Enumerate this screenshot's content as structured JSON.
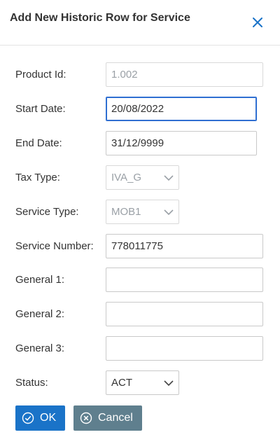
{
  "dialog": {
    "title": "Add New Historic Row for Service",
    "close_icon": "close-icon"
  },
  "form": {
    "product_id": {
      "label": "Product Id:",
      "value": "1.002",
      "disabled": true
    },
    "start_date": {
      "label": "Start Date:",
      "value": "20/08/2022",
      "focused": true
    },
    "end_date": {
      "label": "End Date:",
      "value": "31/12/9999"
    },
    "tax_type": {
      "label": "Tax Type:",
      "value": "IVA_G",
      "disabled": true
    },
    "service_type": {
      "label": "Service Type:",
      "value": "MOB1",
      "disabled": true
    },
    "service_number": {
      "label": "Service Number:",
      "value": "778011775"
    },
    "general_1": {
      "label": "General 1:",
      "value": ""
    },
    "general_2": {
      "label": "General 2:",
      "value": ""
    },
    "general_3": {
      "label": "General 3:",
      "value": ""
    },
    "status": {
      "label": "Status:",
      "value": "ACT"
    }
  },
  "buttons": {
    "ok_label": "OK",
    "cancel_label": "Cancel"
  },
  "colors": {
    "primary": "#1a73c8",
    "secondary": "#5f7f8e",
    "focus": "#2f6fd1"
  }
}
